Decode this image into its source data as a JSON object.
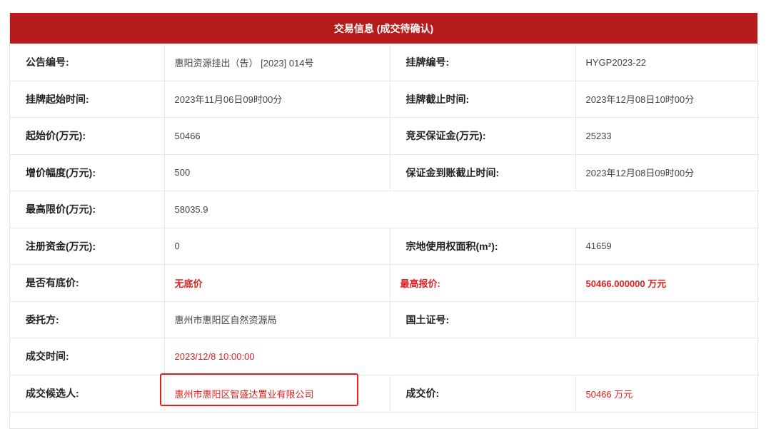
{
  "header": {
    "title": "交易信息 (成交待确认)"
  },
  "rows": [
    {
      "l1": "公告编号:",
      "v1": "惠阳资源挂出（告） [2023] 014号",
      "l2": "挂牌编号:",
      "v2": "HYGP2023-22"
    },
    {
      "l1": "挂牌起始时间:",
      "v1": "2023年11月06日09时00分",
      "l2": "挂牌截止时间:",
      "v2": "2023年12月08日10时00分"
    },
    {
      "l1": "起始价(万元):",
      "v1": "50466",
      "l2": "竞买保证金(万元):",
      "v2": "25233"
    },
    {
      "l1": "增价幅度(万元):",
      "v1": "500",
      "l2": "保证金到账截止时间:",
      "v2": "2023年12月08日09时00分"
    },
    {
      "l1": "最高限价(万元):",
      "v1": "58035.9",
      "l2": "",
      "v2": ""
    },
    {
      "l1": "注册资金(万元):",
      "v1": "0",
      "l2": "宗地使用权面积(m²):",
      "v2": "41659"
    },
    {
      "l1": "是否有底价:",
      "v1": "无底价",
      "l2": "最高报价:",
      "v2": "50466.000000 万元"
    },
    {
      "l1": "委托方:",
      "v1": "惠州市惠阳区自然资源局",
      "l2": "国土证号:",
      "v2": ""
    },
    {
      "l1": "成交时间:",
      "v1": "2023/12/8 10:00:00",
      "l2": "",
      "v2": ""
    },
    {
      "l1": "成交候选人:",
      "v1": "惠州市惠阳区智盛达置业有限公司",
      "l2": "成交价:",
      "v2": "50466 万元"
    }
  ],
  "colors": {
    "header_bg": "#b71c1c",
    "emphasis": "#e02020"
  }
}
